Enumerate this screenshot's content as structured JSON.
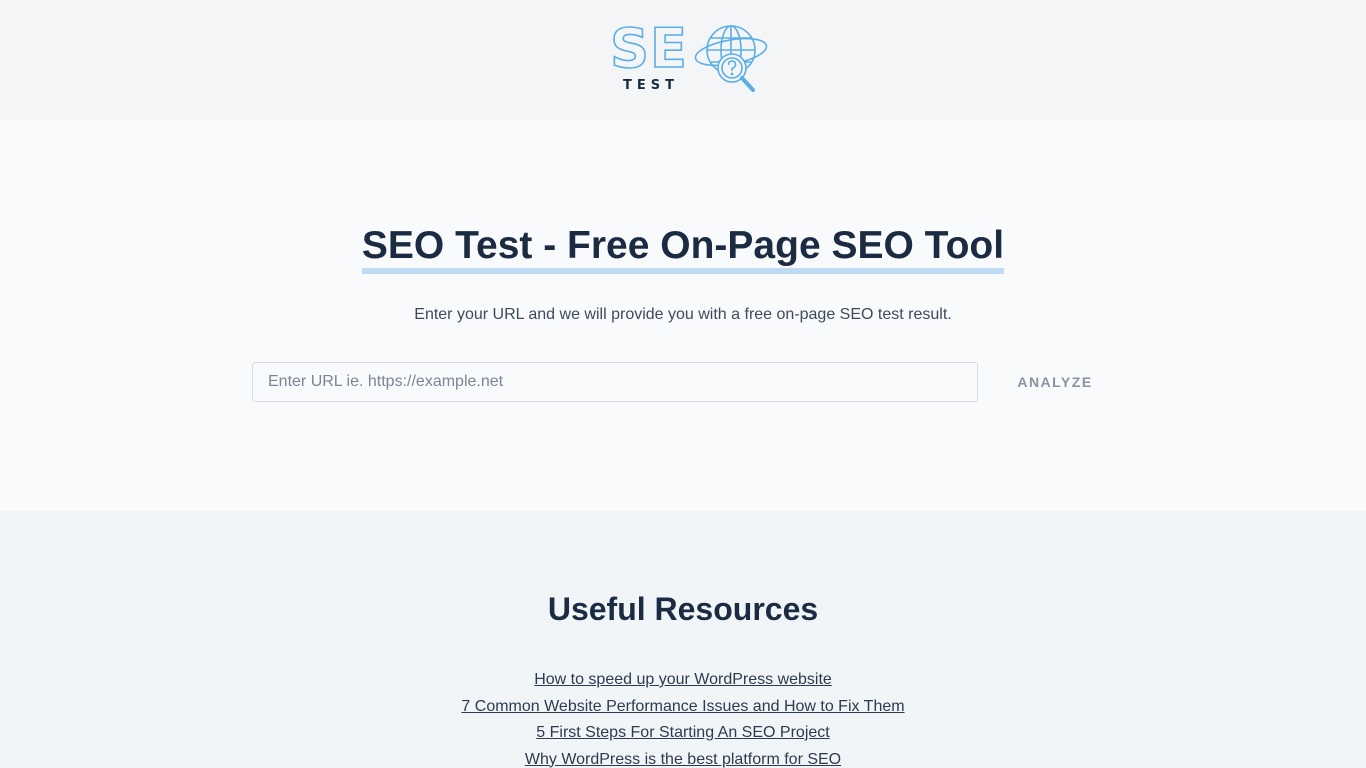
{
  "header": {
    "logo_se": "SE",
    "logo_test": "TEST"
  },
  "hero": {
    "title": "SEO Test - Free On-Page SEO Tool",
    "subtitle": "Enter your URL and we will provide you with a free on-page SEO test result.",
    "url_placeholder": "Enter URL ie. https://example.net",
    "url_value": "",
    "analyze_label": "ANALYZE"
  },
  "resources": {
    "title": "Useful Resources",
    "links": [
      "How to speed up your WordPress website",
      "7 Common Website Performance Issues and How to Fix Them",
      "5 First Steps For Starting An SEO Project",
      "Why WordPress is the best platform for SEO"
    ]
  },
  "colors": {
    "accent": "#5aaee8",
    "title_underline": "#bfdcf6",
    "text_dark": "#1a2b42"
  },
  "icons": {
    "logo_icon": "globe-magnifier-question-icon"
  }
}
